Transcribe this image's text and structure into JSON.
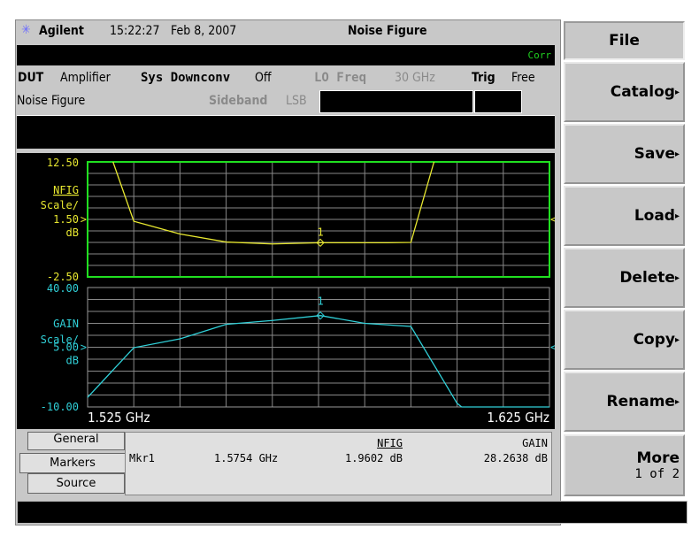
{
  "header": {
    "brand": "Agilent",
    "time": "15:22:27",
    "date": "Feb 8, 2007",
    "title": "Noise Figure",
    "corr": "Corr"
  },
  "settings": {
    "dut_label": "DUT",
    "dut_value": "Amplifier",
    "sys_label": "Sys Downconv",
    "sys_value": "Off",
    "lo_label": "LO Freq",
    "lo_value": "30 GHz",
    "trig_label": "Trig",
    "trig_value": "Free",
    "mode": "Noise Figure",
    "sideband_label": "Sideband",
    "sideband_value": "LSB"
  },
  "colors": {
    "nfig": "#e8e830",
    "gain": "#30d0d8",
    "frame": "#20e020"
  },
  "chart_data": [
    {
      "type": "line",
      "name": "NFIG",
      "ylabel": "NFIG",
      "scale": "Scale/",
      "scale_value": "1.50",
      "unit": "dB",
      "top_label": "12.50",
      "bottom_label": "-2.50",
      "ylim": [
        -2.5,
        12.5
      ],
      "ref_level": 5.0,
      "x": [
        1.5305,
        1.535,
        1.545,
        1.555,
        1.565,
        1.5754,
        1.59,
        1.595,
        1.6
      ],
      "values": [
        12.5,
        4.76,
        3.1,
        2.05,
        1.8,
        1.96,
        1.96,
        2.0,
        12.5
      ],
      "marker": {
        "label": "1",
        "x": 1.5754,
        "y": 1.96
      }
    },
    {
      "type": "line",
      "name": "GAIN",
      "ylabel": "GAIN",
      "scale": "Scale/",
      "scale_value": "5.00",
      "unit": "dB",
      "top_label": "40.00",
      "bottom_label": "-10.00",
      "ylim": [
        -10,
        40
      ],
      "ref_level": 15,
      "x": [
        1.525,
        1.535,
        1.545,
        1.555,
        1.565,
        1.5754,
        1.585,
        1.595,
        1.605,
        1.606,
        1.625
      ],
      "values": [
        -6,
        14.8,
        18.5,
        24.6,
        26.2,
        28.26,
        25.0,
        23.7,
        -8.5,
        -10,
        -10
      ],
      "marker": {
        "label": "1",
        "x": 1.5754,
        "y": 28.26
      }
    }
  ],
  "axis": {
    "start": "1.525 GHz",
    "stop": "1.625 GHz",
    "xlim": [
      1.525,
      1.625
    ]
  },
  "tabs": [
    "General",
    "Markers",
    "Source"
  ],
  "markers": {
    "name": "Mkr1",
    "freq": "1.5754 GHz",
    "nfig_head": "NFIG",
    "nfig_val": "1.9602 dB",
    "gain_head": "GAIN",
    "gain_val": "28.2638 dB"
  },
  "softkeys": {
    "title": "File",
    "items": [
      "Catalog",
      "Save",
      "Load",
      "Delete",
      "Copy",
      "Rename"
    ],
    "more": "More",
    "more_sub": "1 of 2"
  }
}
